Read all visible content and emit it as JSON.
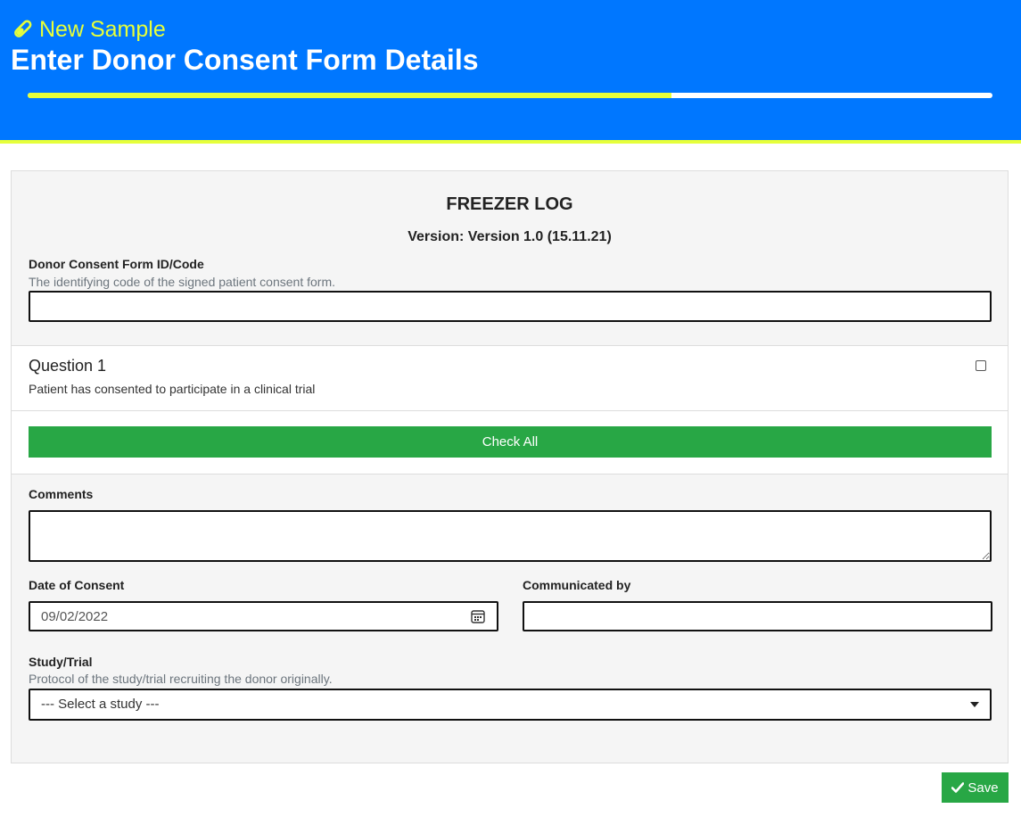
{
  "header": {
    "subtitle": "New Sample",
    "title": "Enter Donor Consent Form Details",
    "progress_fraction": 0.667,
    "accent_color": "#e6ff3a",
    "background_color": "#0077ff"
  },
  "form": {
    "log_title": "FREEZER LOG",
    "version": "Version: Version 1.0 (15.11.21)",
    "consent_id": {
      "label": "Donor Consent Form ID/Code",
      "help": "The identifying code of the signed patient consent form.",
      "value": ""
    },
    "question": {
      "title": "Question 1",
      "text": "Patient has consented to participate in a clinical trial",
      "checked": false
    },
    "check_all_label": "Check All",
    "comments": {
      "label": "Comments",
      "value": ""
    },
    "date_of_consent": {
      "label": "Date of Consent",
      "value": "09/02/2022",
      "icon": "calendar-icon"
    },
    "communicated_by": {
      "label": "Communicated by",
      "value": ""
    },
    "study": {
      "label": "Study/Trial",
      "help": "Protocol of the study/trial recruiting the donor originally.",
      "selected": "--- Select a study ---"
    }
  },
  "actions": {
    "save_label": "Save",
    "save_icon": "check-icon",
    "button_color": "#28a745"
  }
}
